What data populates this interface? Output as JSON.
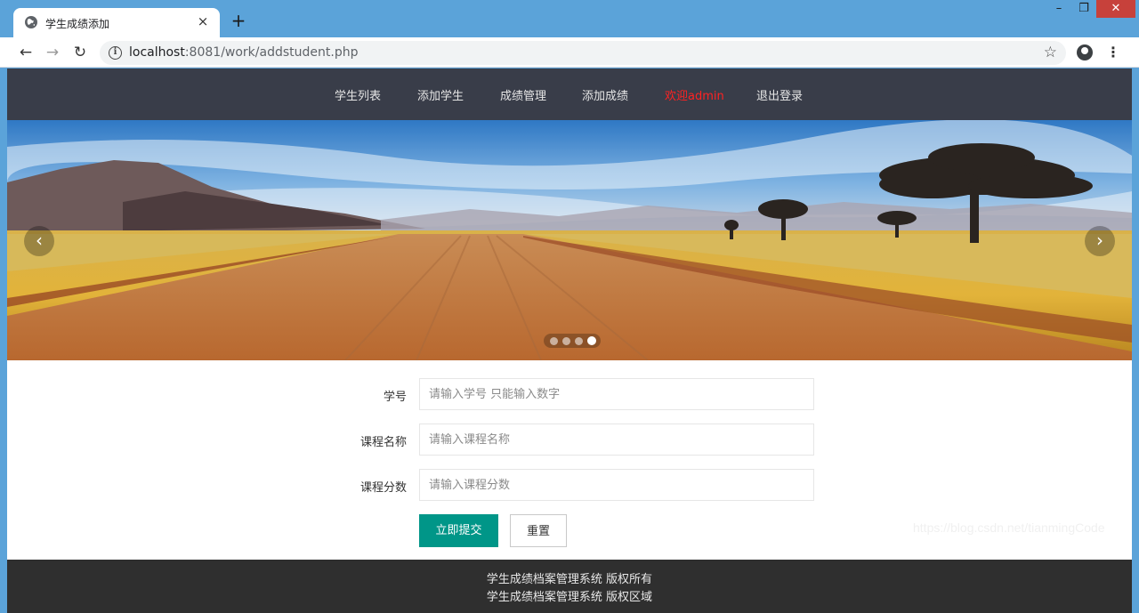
{
  "browser": {
    "tab_title": "学生成绩添加",
    "tab_close": "×",
    "new_tab": "+",
    "url_host": "localhost",
    "url_rest": ":8081/work/addstudent.php",
    "window_min": "–",
    "window_max": "❐",
    "window_close": "✕"
  },
  "nav": {
    "items": [
      {
        "label": "学生列表"
      },
      {
        "label": "添加学生"
      },
      {
        "label": "成绩管理"
      },
      {
        "label": "添加成绩"
      },
      {
        "label": "欢迎admin"
      },
      {
        "label": "退出登录"
      }
    ],
    "active_color": "#ff2222"
  },
  "carousel": {
    "prev": "‹",
    "next": "›",
    "slide_count": 4,
    "active_slide": 4
  },
  "form": {
    "student_id_label": "学号",
    "student_id_placeholder": "请输入学号 只能输入数字",
    "course_label": "课程名称",
    "course_placeholder": "请输入课程名称",
    "score_label": "课程分数",
    "score_placeholder": "请输入课程分数",
    "submit_label": "立即提交",
    "reset_label": "重置"
  },
  "footer": {
    "line1": "学生成绩档案管理系统 版权所有",
    "line2": "学生成绩档案管理系统 版权区域"
  },
  "watermark": "https://blog.csdn.net/tianmingCode",
  "colors": {
    "nav_bg": "#393d49",
    "primary": "#009688",
    "footer_bg": "#2f2f2f"
  }
}
